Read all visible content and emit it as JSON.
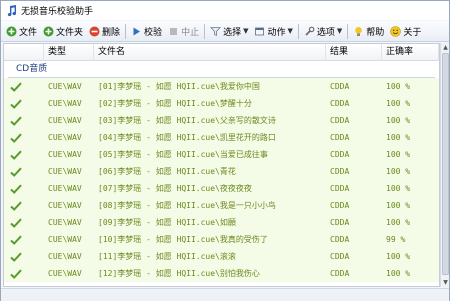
{
  "window": {
    "title": "无损音乐校验助手"
  },
  "toolbar": {
    "items": [
      {
        "label": "文件",
        "icon": "add-file-icon"
      },
      {
        "label": "文件夹",
        "icon": "add-folder-icon"
      },
      {
        "label": "删除",
        "icon": "delete-icon"
      },
      {
        "label": "校验",
        "icon": "play-icon"
      },
      {
        "label": "中止",
        "icon": "stop-icon"
      },
      {
        "label": "选择",
        "icon": "filter-icon"
      },
      {
        "label": "动作",
        "icon": "action-icon"
      },
      {
        "label": "选项",
        "icon": "wrench-icon"
      },
      {
        "label": "帮助",
        "icon": "bulb-icon"
      },
      {
        "label": "关于",
        "icon": "smiley-icon"
      }
    ]
  },
  "list": {
    "columns": {
      "type": "类型",
      "name": "文件名",
      "result": "结果",
      "rate": "正确率"
    },
    "group": "CD音质",
    "rows": [
      {
        "type": "CUE\\WAV",
        "name": "[01]李梦瑶 - 如愿 HQII.cue\\我爱你中国",
        "result": "CDDA",
        "rate": "100 %"
      },
      {
        "type": "CUE\\WAV",
        "name": "[02]李梦瑶 - 如愿 HQII.cue\\梦醒十分",
        "result": "CDDA",
        "rate": "100 %"
      },
      {
        "type": "CUE\\WAV",
        "name": "[03]李梦瑶 - 如愿 HQII.cue\\父亲写的散文诗",
        "result": "CDDA",
        "rate": "100 %"
      },
      {
        "type": "CUE\\WAV",
        "name": "[04]李梦瑶 - 如愿 HQII.cue\\凯里花开的路口",
        "result": "CDDA",
        "rate": "100 %"
      },
      {
        "type": "CUE\\WAV",
        "name": "[05]李梦瑶 - 如愿 HQII.cue\\当爱已成往事",
        "result": "CDDA",
        "rate": "100 %"
      },
      {
        "type": "CUE\\WAV",
        "name": "[06]李梦瑶 - 如愿 HQII.cue\\青花",
        "result": "CDDA",
        "rate": "100 %"
      },
      {
        "type": "CUE\\WAV",
        "name": "[07]李梦瑶 - 如愿 HQII.cue\\夜夜夜夜",
        "result": "CDDA",
        "rate": "100 %"
      },
      {
        "type": "CUE\\WAV",
        "name": "[08]李梦瑶 - 如愿 HQII.cue\\我是一只小小鸟",
        "result": "CDDA",
        "rate": "100 %"
      },
      {
        "type": "CUE\\WAV",
        "name": "[09]李梦瑶 - 如愿 HQII.cue\\如願",
        "result": "CDDA",
        "rate": "100 %"
      },
      {
        "type": "CUE\\WAV",
        "name": "[10]李梦瑶 - 如愿 HQII.cue\\我真的受伤了",
        "result": "CDDA",
        "rate": "99 %"
      },
      {
        "type": "CUE\\WAV",
        "name": "[11]李梦瑶 - 如愿 HQII.cue\\滚滚",
        "result": "CDDA",
        "rate": "100 %"
      },
      {
        "type": "CUE\\WAV",
        "name": "[12]李梦瑶 - 如愿 HQII.cue\\别怕我伤心",
        "result": "CDDA",
        "rate": "100 %"
      }
    ]
  },
  "colors": {
    "row_bg": "#f4fbe6",
    "row_text": "#6b8a1e",
    "check": "#5a9a2a",
    "group_text": "#1d3f7a"
  }
}
